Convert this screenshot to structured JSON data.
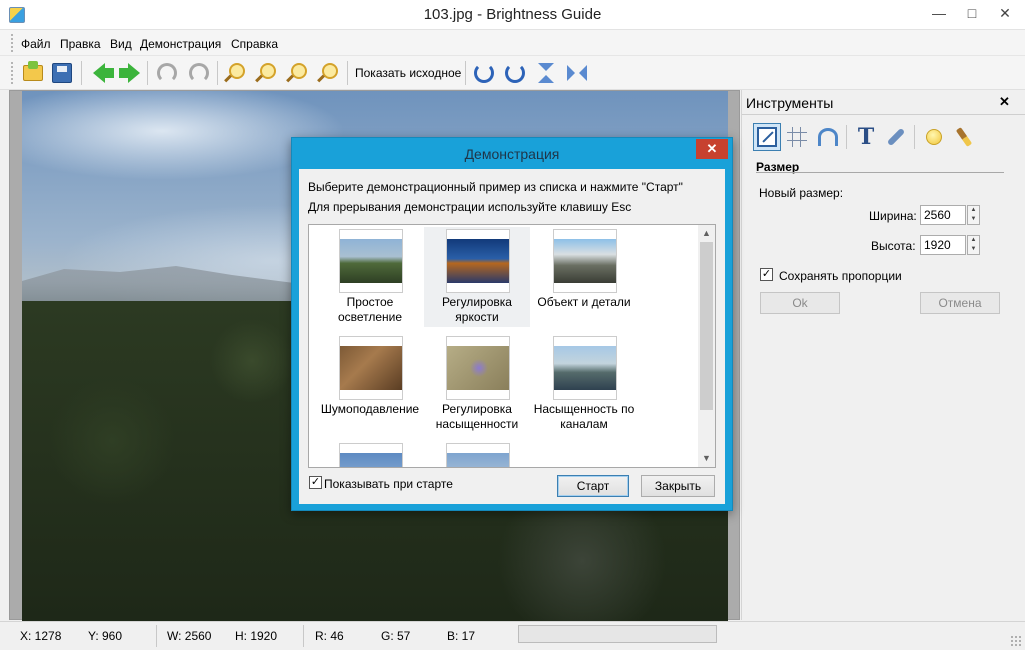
{
  "window": {
    "title": "103.jpg - Brightness Guide"
  },
  "menu": [
    "Файл",
    "Правка",
    "Вид",
    "Демонстрация",
    "Справка"
  ],
  "toolbar": {
    "show_original_label": "Показать исходное"
  },
  "dialog": {
    "title": "Демонстрация",
    "line1": "Выберите демонстрационный пример из списка и нажмите \"Старт\"",
    "line2": "Для прерывания демонстрации используйте клавишу Esc",
    "items": [
      {
        "line1": "Простое",
        "line2": "осветление"
      },
      {
        "line1": "Регулировка",
        "line2": "яркости"
      },
      {
        "line1": "Объект и детали",
        "line2": ""
      },
      {
        "line1": "Шумоподавление",
        "line2": ""
      },
      {
        "line1": "Регулировка",
        "line2": "насыщенности"
      },
      {
        "line1": "Насыщенность по",
        "line2": "каналам"
      }
    ],
    "selected_index": 1,
    "show_on_start_label": "Показывать при старте",
    "show_on_start_checked": true,
    "start_label": "Старт",
    "close_label": "Закрыть"
  },
  "tools": {
    "title": "Инструменты",
    "section": "Размер",
    "new_size_label": "Новый размер:",
    "width_label": "Ширина:",
    "width_value": "2560",
    "height_label": "Высота:",
    "height_value": "1920",
    "keep_ratio_label": "Сохранять пропорции",
    "keep_ratio_checked": true,
    "ok_label": "Ok",
    "cancel_label": "Отмена"
  },
  "status": {
    "x": "X: 1278",
    "y": "Y: 960",
    "w": "W: 2560",
    "h": "H: 1920",
    "r": "R: 46",
    "g": "G: 57",
    "b": "B: 17"
  },
  "icons": {
    "toolbar": [
      "open-icon",
      "save-icon",
      "back-icon",
      "forward-icon",
      "undo-icon",
      "redo-icon",
      "zoom-in-icon",
      "zoom-out-icon",
      "zoom-fit-icon",
      "zoom-actual-icon",
      "rotate-cw-icon",
      "rotate-ccw-icon",
      "flip-vertical-icon",
      "flip-horizontal-icon"
    ],
    "tools": [
      "resize-icon",
      "crop-grid-icon",
      "undo-tool-icon",
      "text-icon",
      "wrench-icon",
      "bulb-icon",
      "brush-icon"
    ]
  },
  "colors": {
    "dialog_frame": "#19a1d9",
    "dialog_close": "#c7412f",
    "arrow_green": "#3cb43c"
  }
}
